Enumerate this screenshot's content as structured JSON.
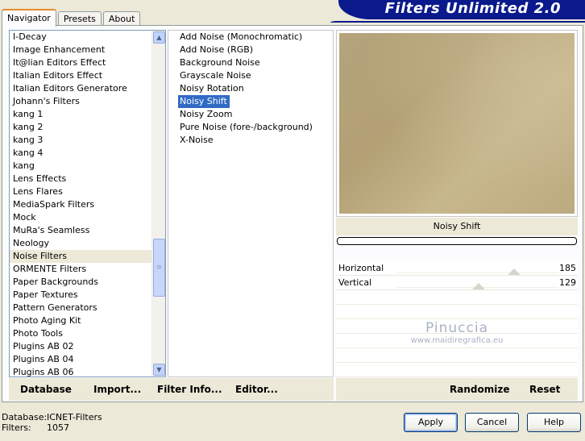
{
  "header": {
    "title": "Filters Unlimited 2.0"
  },
  "tabs": [
    {
      "label": "Navigator",
      "active": true
    },
    {
      "label": "Presets",
      "active": false
    },
    {
      "label": "About",
      "active": false
    }
  ],
  "categories": {
    "selected": "Noise Filters",
    "items": [
      "I-Decay",
      "Image Enhancement",
      "It@lian Editors Effect",
      "Italian Editors Effect",
      "Italian Editors Generatore",
      "Johann's Filters",
      "kang 1",
      "kang 2",
      "kang 3",
      "kang 4",
      "kang",
      "Lens Effects",
      "Lens Flares",
      "MediaSpark Filters",
      "Mock",
      "MuRa's Seamless",
      "Neology",
      "Noise Filters",
      "ORMENTE Filters",
      "Paper Backgrounds",
      "Paper Textures",
      "Pattern Generators",
      "Photo Aging Kit",
      "Photo Tools",
      "Plugins AB 02",
      "Plugins AB 04",
      "Plugins AB 06"
    ]
  },
  "filters": {
    "selected": "Noisy Shift",
    "items": [
      "Add Noise (Monochromatic)",
      "Add Noise (RGB)",
      "Background Noise",
      "Grayscale Noise",
      "Noisy Rotation",
      "Noisy Shift",
      "Noisy Zoom",
      "Pure Noise (fore-/background)",
      "X-Noise"
    ]
  },
  "preview": {
    "filter_name": "Noisy Shift",
    "progress": 0
  },
  "params": [
    {
      "label": "Horizontal",
      "value": "185",
      "fraction": 0.725
    },
    {
      "label": "Vertical",
      "value": "129",
      "fraction": 0.506
    }
  ],
  "watermark": {
    "line1": "Pinuccia",
    "line2": "www.maidiregrafica.eu"
  },
  "bottom_left": {
    "database": "Database",
    "import": "Import...",
    "filter_info": "Filter Info...",
    "editor": "Editor..."
  },
  "bottom_right": {
    "randomize": "Randomize",
    "reset": "Reset"
  },
  "status": {
    "database_label": "Database:",
    "database_value": "ICNET-Filters",
    "filters_label": "Filters:",
    "filters_value": "1057"
  },
  "buttons": {
    "apply": "Apply",
    "cancel": "Cancel",
    "help": "Help"
  },
  "colors": {
    "banner": "#0a1a8c",
    "selection": "#316ac5",
    "accent_tab": "#e68b2c"
  },
  "icons": {
    "scroll_up": "arrow-up-icon",
    "scroll_down": "arrow-down-icon"
  }
}
